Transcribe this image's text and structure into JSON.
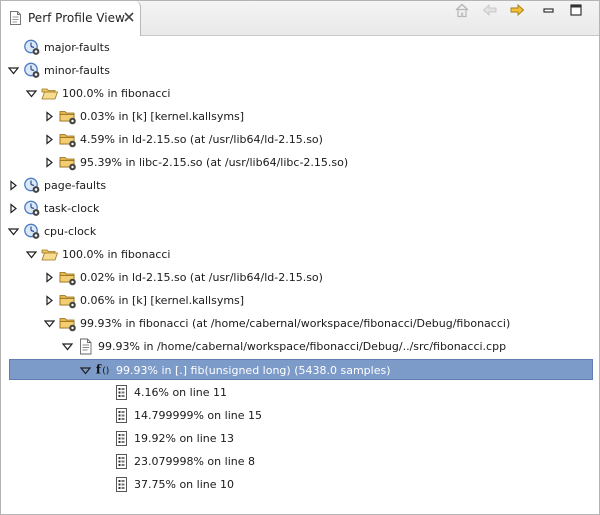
{
  "view": {
    "title": "Perf Profile View",
    "toolbar_icons": [
      "home-icon",
      "back-arrow-icon",
      "forward-arrow-icon",
      "minimize-icon",
      "maximize-icon"
    ]
  },
  "tree": {
    "rows": [
      {
        "label": "major-faults",
        "icon": "event-clock-icon",
        "twisty": "none"
      },
      {
        "label": "minor-faults",
        "icon": "event-clock-icon",
        "twisty": "expanded"
      },
      {
        "label": "100.0% in fibonacci",
        "icon": "open-folder-icon",
        "twisty": "expanded"
      },
      {
        "label": "0.03% in [k] [kernel.kallsyms]",
        "icon": "dso-folder-icon",
        "twisty": "collapsed"
      },
      {
        "label": "4.59% in ld-2.15.so (at /usr/lib64/ld-2.15.so)",
        "icon": "dso-folder-icon",
        "twisty": "collapsed"
      },
      {
        "label": "95.39% in libc-2.15.so (at /usr/lib64/libc-2.15.so)",
        "icon": "dso-folder-icon",
        "twisty": "collapsed"
      },
      {
        "label": "page-faults",
        "icon": "event-clock-icon",
        "twisty": "collapsed"
      },
      {
        "label": "task-clock",
        "icon": "event-clock-icon",
        "twisty": "collapsed"
      },
      {
        "label": "cpu-clock",
        "icon": "event-clock-icon",
        "twisty": "expanded"
      },
      {
        "label": "100.0% in fibonacci",
        "icon": "open-folder-icon",
        "twisty": "expanded"
      },
      {
        "label": "0.02% in ld-2.15.so (at /usr/lib64/ld-2.15.so)",
        "icon": "dso-folder-icon",
        "twisty": "collapsed"
      },
      {
        "label": "0.06% in [k] [kernel.kallsyms]",
        "icon": "dso-folder-icon",
        "twisty": "collapsed"
      },
      {
        "label": "99.93% in fibonacci (at /home/cabernal/workspace/fibonacci/Debug/fibonacci)",
        "icon": "dso-folder-icon",
        "twisty": "expanded"
      },
      {
        "label": "99.93% in /home/cabernal/workspace/fibonacci/Debug/../src/fibonacci.cpp",
        "icon": "source-file-icon",
        "twisty": "expanded"
      },
      {
        "label": "99.93% in [.] fib(unsigned long) (5438.0 samples)",
        "icon": "function-icon",
        "twisty": "expanded",
        "selected": true
      },
      {
        "label": "4.16% on line 11",
        "icon": "line-icon",
        "twisty": "none"
      },
      {
        "label": "14.799999% on line 15",
        "icon": "line-icon",
        "twisty": "none"
      },
      {
        "label": "19.92% on line 13",
        "icon": "line-icon",
        "twisty": "none"
      },
      {
        "label": "23.079998% on line 8",
        "icon": "line-icon",
        "twisty": "none"
      },
      {
        "label": "37.75% on line 10",
        "icon": "line-icon",
        "twisty": "none"
      }
    ]
  },
  "colors": {
    "selection": "#7d9bc8",
    "folder": "#e8b64a",
    "clock": "#4a7cc4"
  }
}
